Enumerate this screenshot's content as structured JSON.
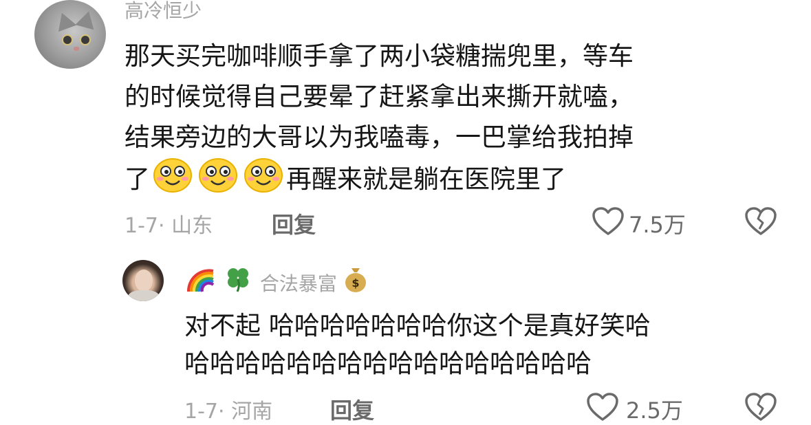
{
  "comment": {
    "username": "高冷恒少",
    "text_line1": "那天买完咖啡顺手拿了两小袋糖揣兜里，等车",
    "text_line2": "的时候觉得自己要晕了赶紧拿出来撕开就嗑，",
    "text_line3": "结果旁边的大哥以为我嗑毒，一巴掌给我拍掉",
    "text_line4a": "了",
    "text_line4b": "再醒来就是躺在医院里了",
    "emojis": [
      "smile-emoji",
      "smile-emoji",
      "smile-emoji"
    ],
    "date": "1-7",
    "separator": "·",
    "location": "山东",
    "reply_label": "回复",
    "like_count": "7.5万"
  },
  "reply": {
    "username_prefix_icons": [
      "rainbow-icon",
      "clover-icon"
    ],
    "username": "合法暴富",
    "username_suffix_icon": "money-bag-icon",
    "text_line1": "对不起  哈哈哈哈哈哈哈你这个是真好笑哈",
    "text_line2": "哈哈哈哈哈哈哈哈哈哈哈哈哈哈哈哈",
    "date": "1-7",
    "separator": "·",
    "location": "河南",
    "reply_label": "回复",
    "like_count": "2.5万"
  },
  "colors": {
    "text": "#161616",
    "muted": "#a5a5a5",
    "action": "#6a6a6a",
    "emoji_face": "#ffd23a"
  }
}
